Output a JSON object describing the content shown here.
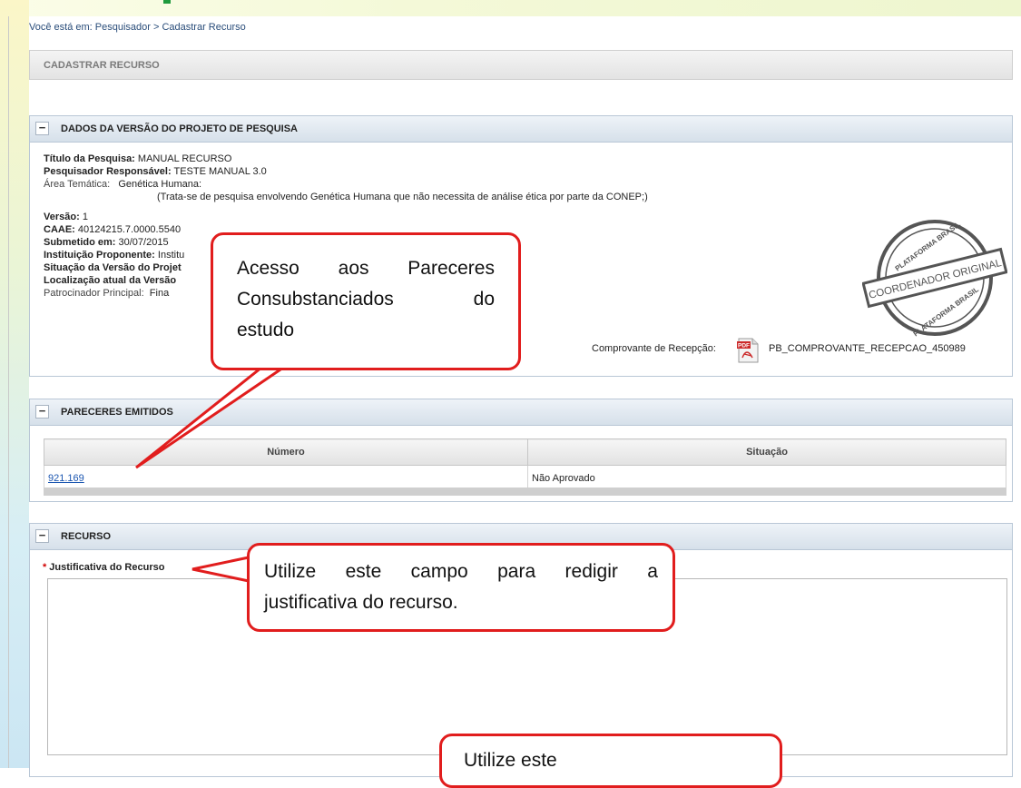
{
  "breadcrumb": "Você está em: Pesquisador > Cadastrar Recurso",
  "page_title": "CADASTRAR RECURSO",
  "panel_versao": {
    "toggle": "−",
    "title": "DADOS DA VERSÃO DO PROJETO DE PESQUISA",
    "titulo_label": "Título da Pesquisa:",
    "titulo_value": "MANUAL RECURSO",
    "pesquisador_label": "Pesquisador Responsável:",
    "pesquisador_value": "TESTE MANUAL 3.0",
    "area_label": "Área Temática:",
    "area_value": "Genética Humana:",
    "area_note": "(Trata-se de pesquisa envolvendo Genética Humana que não necessita de análise ética por parte da CONEP;)",
    "versao_label": "Versão:",
    "versao_value": "1",
    "caae_label": "CAAE:",
    "caae_value": "40124215.7.0000.5540",
    "submetido_label": "Submetido em:",
    "submetido_value": "30/07/2015",
    "instituicao_label": "Instituição Proponente:",
    "instituicao_value": "Institu",
    "situacao_label": "Situação da Versão do Projet",
    "localizacao_label": "Localização atual da Versão",
    "patrocinador_label": "Patrocinador Principal:",
    "patrocinador_value": "Fina",
    "receipt_label": "Comprovante de Recepção:",
    "receipt_file": "PB_COMPROVANTE_RECEPCAO_450989",
    "pdf_icon_text": "PDF",
    "stamp_top": "PLATAFORMA BRASIL",
    "stamp_mid": "COORDENADOR ORIGINAL",
    "stamp_bottom": "PLATAFORMA BRASIL"
  },
  "panel_pareceres": {
    "toggle": "−",
    "title": "PARECERES EMITIDOS",
    "headers": [
      "Número",
      "Situação"
    ],
    "rows": [
      {
        "numero": "921.169",
        "situacao": "Não Aprovado"
      }
    ]
  },
  "panel_recurso": {
    "toggle": "−",
    "title": "RECURSO",
    "field_label": "Justificativa do Recurso",
    "required_mark": "*"
  },
  "callouts": {
    "c1_line1": [
      "Acesso",
      "aos",
      "Pareceres"
    ],
    "c1_line2": [
      "Consubstanciados",
      "do"
    ],
    "c1_line3": "estudo",
    "c2_line1": [
      "Utilize",
      "este",
      "campo",
      "para",
      "redigir",
      "a"
    ],
    "c2_line2": "justificativa do recurso.",
    "c3_line1": "Utilize este"
  },
  "colors": {
    "callout_border": "#e11d1d",
    "link": "#1a55b0",
    "required": "#d00000"
  }
}
